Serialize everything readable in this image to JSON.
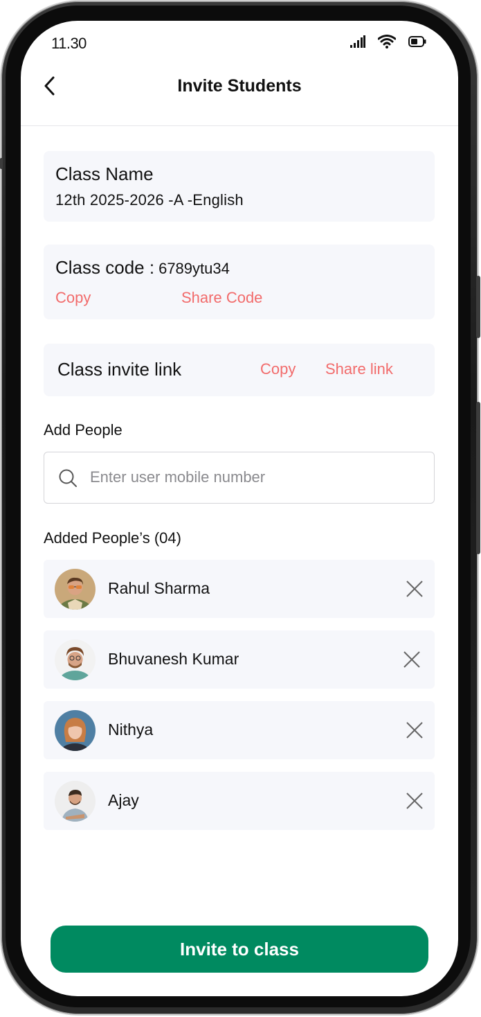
{
  "status_bar": {
    "time": "11.30",
    "icons": [
      "cellular-signal-icon",
      "wifi-icon",
      "battery-icon"
    ]
  },
  "header": {
    "title": "Invite Students",
    "back_icon": "chevron-left-icon"
  },
  "class_name_card": {
    "label": "Class Name",
    "value": "12th 2025-2026 -A -English"
  },
  "class_code_card": {
    "label": "Class code :",
    "value": "6789ytu34",
    "copy_label": "Copy",
    "share_label": "Share Code"
  },
  "invite_link_card": {
    "label": "Class invite link",
    "copy_label": "Copy",
    "share_label": "Share link"
  },
  "add_people": {
    "label": "Add People",
    "search_placeholder": "Enter user mobile number",
    "search_value": ""
  },
  "added_people": {
    "label": "Added People’s (04)",
    "people": [
      {
        "name": "Rahul Sharma"
      },
      {
        "name": "Bhuvanesh Kumar"
      },
      {
        "name": "Nithya"
      },
      {
        "name": "Ajay"
      }
    ]
  },
  "invite_button": {
    "label": "Invite to class"
  },
  "colors": {
    "accent_link": "#f26b6b",
    "primary_button": "#008a60",
    "card_background": "#f6f7fb"
  }
}
